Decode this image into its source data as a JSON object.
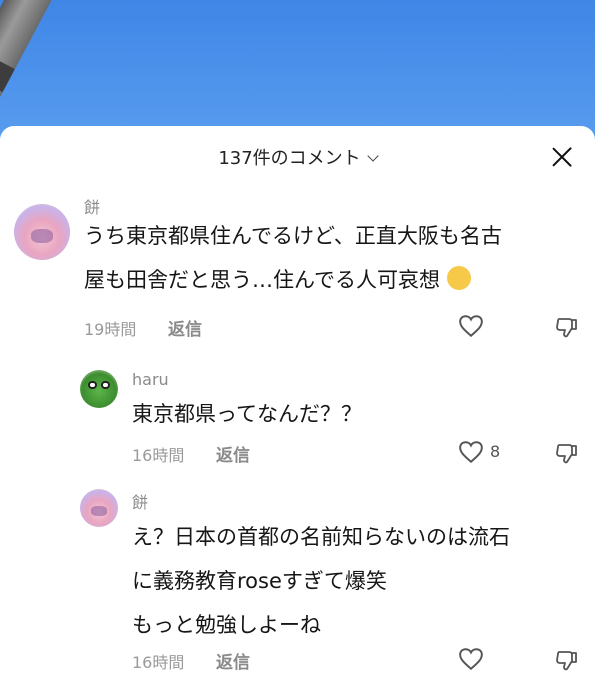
{
  "header": {
    "title": "137件のコメント"
  },
  "comments": [
    {
      "user": "餅",
      "lines": [
        "うち東京都県住んでるけど、正直大阪も名古",
        "屋も田舎だと思う…住んでる人可哀想"
      ],
      "emoji": "crying-face",
      "time": "19時間",
      "reply": "返信"
    },
    {
      "user": "haru",
      "lines": [
        "東京都県ってなんだ？？"
      ],
      "time": "16時間",
      "reply": "返信",
      "likes": "8"
    },
    {
      "user": "餅",
      "lines": [
        "え？日本の首都の名前知らないのは流石",
        "に義務教育roseすぎて爆笑",
        "もっと勉強しよーね"
      ],
      "time": "16時間",
      "reply": "返信"
    }
  ],
  "icons": {
    "close": "close-icon",
    "chevron": "chevron-down-icon",
    "like": "heart-icon",
    "dislike": "thumbs-down-icon"
  }
}
